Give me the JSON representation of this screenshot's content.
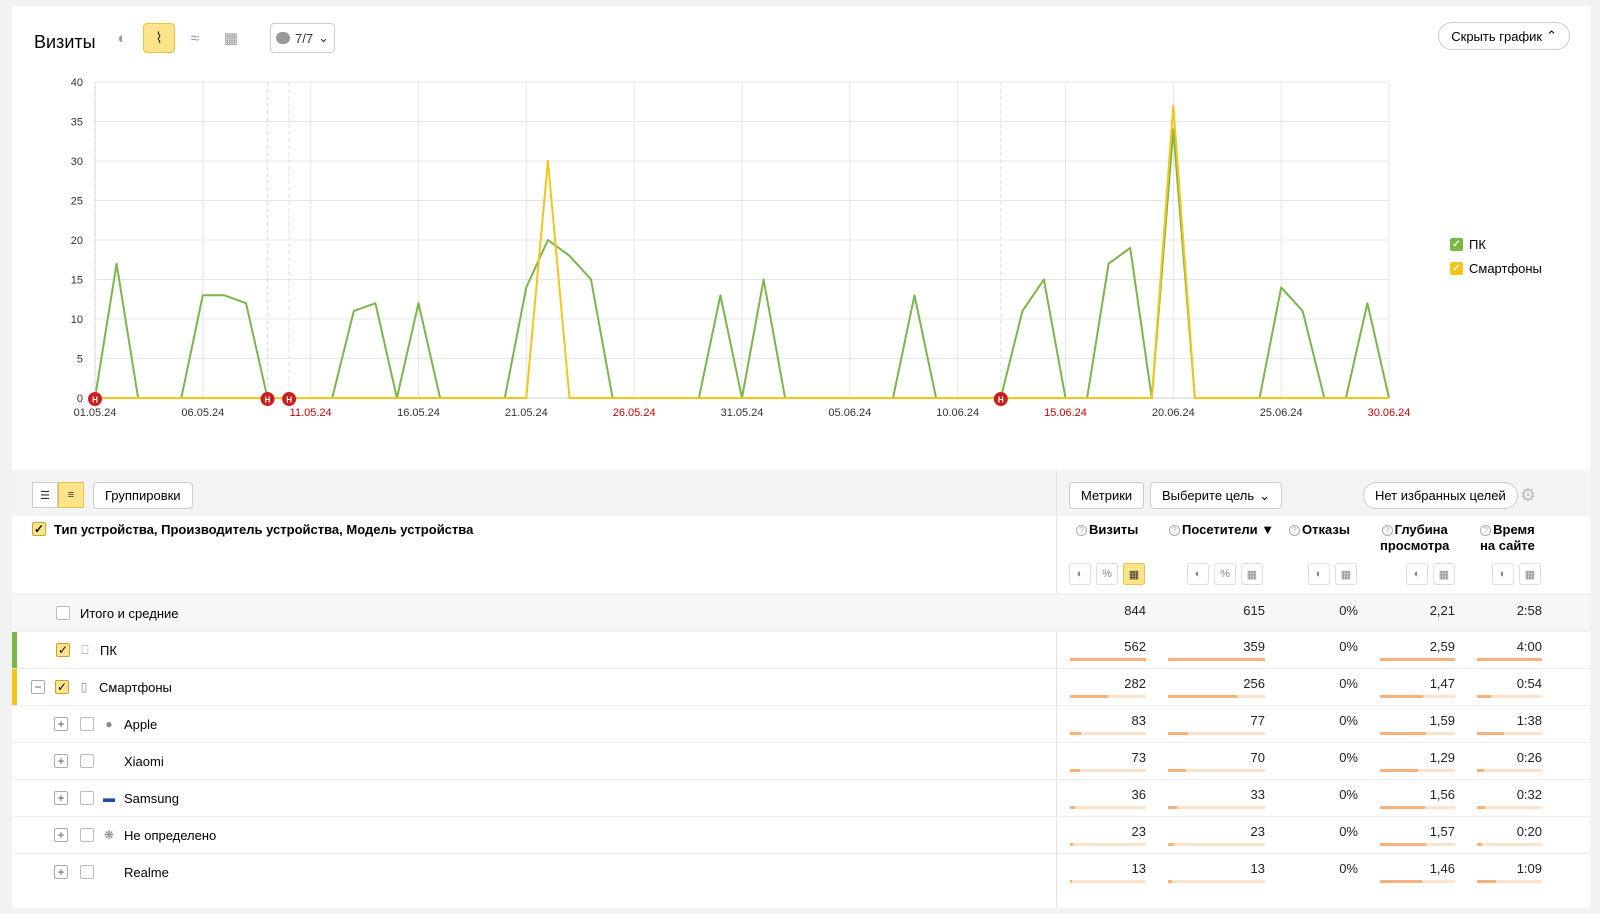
{
  "chart_panel": {
    "title": "Визиты",
    "annotations_label": "7/7",
    "hide_chart_label": "Скрыть график",
    "icons": {
      "pie": "pie-chart-icon",
      "line": "line-chart-icon",
      "area": "area-chart-icon",
      "bar": "bar-chart-icon",
      "annotation": "comment-icon"
    }
  },
  "chart_data": {
    "type": "line",
    "ylim": [
      0,
      40
    ],
    "yticks": [
      0,
      5,
      10,
      15,
      20,
      25,
      30,
      35,
      40
    ],
    "x_start": "01.05.24",
    "x_end": "30.06.24",
    "xtick_labels": [
      {
        "label": "01.05.24",
        "day": 0,
        "holiday": false
      },
      {
        "label": "06.05.24",
        "day": 5,
        "holiday": false
      },
      {
        "label": "11.05.24",
        "day": 10,
        "holiday": true
      },
      {
        "label": "16.05.24",
        "day": 15,
        "holiday": false
      },
      {
        "label": "21.05.24",
        "day": 20,
        "holiday": false
      },
      {
        "label": "26.05.24",
        "day": 25,
        "holiday": true
      },
      {
        "label": "31.05.24",
        "day": 30,
        "holiday": false
      },
      {
        "label": "05.06.24",
        "day": 35,
        "holiday": false
      },
      {
        "label": "10.06.24",
        "day": 40,
        "holiday": false
      },
      {
        "label": "15.06.24",
        "day": 45,
        "holiday": true
      },
      {
        "label": "20.06.24",
        "day": 50,
        "holiday": false
      },
      {
        "label": "25.06.24",
        "day": 55,
        "holiday": false
      },
      {
        "label": "30.06.24",
        "day": 60,
        "holiday": true
      }
    ],
    "annotation_marker": "Н",
    "annotation_days": [
      0,
      8,
      9,
      42
    ],
    "series": [
      {
        "name": "ПК",
        "color": "#7ab648",
        "values": [
          0,
          17,
          0,
          0,
          0,
          13,
          13,
          12,
          0,
          0,
          0,
          0,
          11,
          12,
          0,
          12,
          0,
          0,
          0,
          0,
          14,
          20,
          18,
          15,
          0,
          0,
          0,
          0,
          0,
          13,
          0,
          15,
          0,
          0,
          0,
          0,
          0,
          0,
          13,
          0,
          0,
          0,
          0,
          11,
          15,
          0,
          0,
          17,
          19,
          0,
          34,
          0,
          0,
          0,
          0,
          14,
          11,
          0,
          0,
          12,
          0
        ]
      },
      {
        "name": "Смартфоны",
        "color": "#f5c518",
        "values": [
          0,
          0,
          0,
          0,
          0,
          0,
          0,
          0,
          0,
          0,
          0,
          0,
          0,
          0,
          0,
          0,
          0,
          0,
          0,
          0,
          0,
          30,
          0,
          0,
          0,
          0,
          0,
          0,
          0,
          0,
          0,
          0,
          0,
          0,
          0,
          0,
          0,
          0,
          0,
          0,
          0,
          0,
          0,
          0,
          0,
          0,
          0,
          0,
          0,
          0,
          37,
          0,
          0,
          0,
          0,
          0,
          0,
          0,
          0,
          0,
          0
        ]
      }
    ]
  },
  "toolbar": {
    "groupings_label": "Группировки",
    "metrics_label": "Метрики",
    "goal_select_label": "Выберите цель",
    "favorites_label": "Нет избранных целей"
  },
  "table": {
    "dimensions_header": "Тип устройства, Производитель устройства, Модель устройства",
    "columns": [
      {
        "key": "visits",
        "label": "Визиты",
        "label2": ""
      },
      {
        "key": "visitors",
        "label": "Посетители ▼",
        "label2": ""
      },
      {
        "key": "bounce",
        "label": "Отказы",
        "label2": ""
      },
      {
        "key": "depth",
        "label": "Глубина",
        "label2": "просмотра"
      },
      {
        "key": "time",
        "label": "Время",
        "label2": "на сайте"
      }
    ],
    "total": {
      "name": "Итого и средние",
      "visits": "844",
      "visitors": "615",
      "bounce": "0%",
      "depth": "2,21",
      "time": "2:58"
    },
    "rows": [
      {
        "name": "ПК",
        "visits": "562",
        "visitors": "359",
        "bounce": "0%",
        "depth": "2,59",
        "time": "4:00",
        "fill": {
          "visits": 1,
          "visitors": 1,
          "depth": 1,
          "time": 1
        }
      },
      {
        "name": "Смартфоны",
        "visits": "282",
        "visitors": "256",
        "bounce": "0%",
        "depth": "1,47",
        "time": "0:54",
        "fill": {
          "visits": 0.5,
          "visitors": 0.71,
          "depth": 0.57,
          "time": 0.22
        }
      },
      {
        "name": "Apple",
        "visits": "83",
        "visitors": "77",
        "bounce": "0%",
        "depth": "1,59",
        "time": "1:38",
        "fill": {
          "visits": 0.15,
          "visitors": 0.21,
          "depth": 0.61,
          "time": 0.41
        }
      },
      {
        "name": "Xiaomi",
        "visits": "73",
        "visitors": "70",
        "bounce": "0%",
        "depth": "1,29",
        "time": "0:26",
        "fill": {
          "visits": 0.13,
          "visitors": 0.19,
          "depth": 0.5,
          "time": 0.11
        }
      },
      {
        "name": "Samsung",
        "visits": "36",
        "visitors": "33",
        "bounce": "0%",
        "depth": "1,56",
        "time": "0:32",
        "fill": {
          "visits": 0.06,
          "visitors": 0.09,
          "depth": 0.6,
          "time": 0.13
        }
      },
      {
        "name": "Не определено",
        "visits": "23",
        "visitors": "23",
        "bounce": "0%",
        "depth": "1,57",
        "time": "0:20",
        "fill": {
          "visits": 0.04,
          "visitors": 0.06,
          "depth": 0.61,
          "time": 0.08
        }
      },
      {
        "name": "Realme",
        "visits": "13",
        "visitors": "13",
        "bounce": "0%",
        "depth": "1,46",
        "time": "1:09",
        "fill": {
          "visits": 0.02,
          "visitors": 0.04,
          "depth": 0.56,
          "time": 0.29
        }
      }
    ]
  }
}
